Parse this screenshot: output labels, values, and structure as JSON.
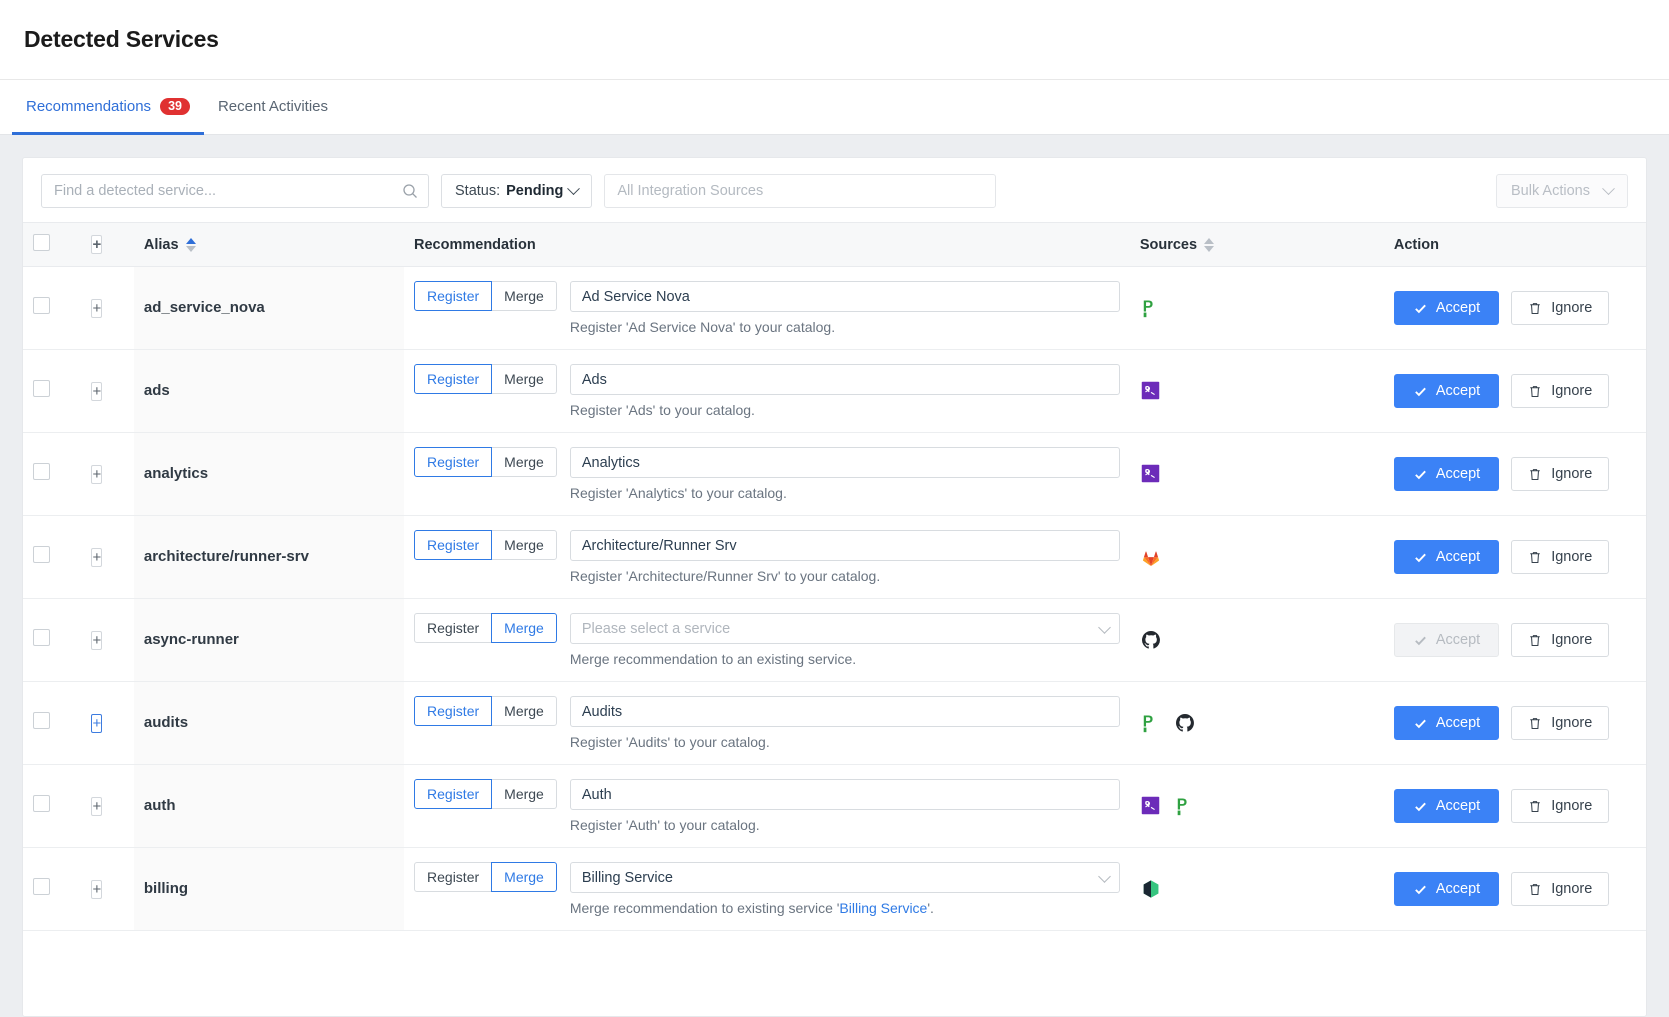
{
  "header": {
    "title": "Detected Services"
  },
  "tabs": [
    {
      "label": "Recommendations",
      "badge": "39",
      "active": true
    },
    {
      "label": "Recent Activities",
      "badge": "",
      "active": false
    }
  ],
  "toolbar": {
    "search_placeholder": "Find a detected service...",
    "search_value": "",
    "search_icon": "search-icon",
    "status_prefix": "Status:",
    "status_value": "Pending",
    "sources_filter_placeholder": "All Integration Sources",
    "bulk_actions_label": "Bulk Actions"
  },
  "table": {
    "columns": {
      "alias": "Alias",
      "recommendation": "Recommendation",
      "sources": "Sources",
      "action": "Action"
    },
    "expand_symbol": "+",
    "accept_label": "Accept",
    "ignore_label": "Ignore",
    "register_label": "Register",
    "merge_label": "Merge",
    "select_placeholder": "Please select a service"
  },
  "colors": {
    "accent": "#2f6fd8",
    "accept_button": "#3b82f6",
    "badge_red": "#e03131",
    "link": "#2f7ae5"
  },
  "rows": [
    {
      "alias": "ad_service_nova",
      "mode": "register",
      "value": "Ad Service Nova",
      "help_prefix": "Register 'Ad Service Nova' to your catalog.",
      "help_link": "",
      "help_suffix": "",
      "sources": [
        "prometheus-icon"
      ],
      "accept_enabled": true,
      "expander_highlight": false
    },
    {
      "alias": "ads",
      "mode": "register",
      "value": "Ads",
      "help_prefix": "Register 'Ads' to your catalog.",
      "help_link": "",
      "help_suffix": "",
      "sources": [
        "datadog-icon"
      ],
      "accept_enabled": true,
      "expander_highlight": false
    },
    {
      "alias": "analytics",
      "mode": "register",
      "value": "Analytics",
      "help_prefix": "Register 'Analytics' to your catalog.",
      "help_link": "",
      "help_suffix": "",
      "sources": [
        "datadog-icon"
      ],
      "accept_enabled": true,
      "expander_highlight": false
    },
    {
      "alias": "architecture/runner-srv",
      "mode": "register",
      "value": "Architecture/Runner Srv",
      "help_prefix": "Register 'Architecture/Runner Srv' to your catalog.",
      "help_link": "",
      "help_suffix": "",
      "sources": [
        "gitlab-icon"
      ],
      "accept_enabled": true,
      "expander_highlight": false
    },
    {
      "alias": "async-runner",
      "mode": "merge",
      "value": "",
      "help_prefix": "Merge recommendation to an existing service.",
      "help_link": "",
      "help_suffix": "",
      "sources": [
        "github-icon"
      ],
      "accept_enabled": false,
      "expander_highlight": false
    },
    {
      "alias": "audits",
      "mode": "register",
      "value": "Audits",
      "help_prefix": "Register 'Audits' to your catalog.",
      "help_link": "",
      "help_suffix": "",
      "sources": [
        "prometheus-icon",
        "github-icon"
      ],
      "accept_enabled": true,
      "expander_highlight": true
    },
    {
      "alias": "auth",
      "mode": "register",
      "value": "Auth",
      "help_prefix": "Register 'Auth' to your catalog.",
      "help_link": "",
      "help_suffix": "",
      "sources": [
        "datadog-icon",
        "prometheus-icon"
      ],
      "accept_enabled": true,
      "expander_highlight": false
    },
    {
      "alias": "billing",
      "mode": "merge",
      "value": "Billing Service",
      "help_prefix": "Merge recommendation to existing service '",
      "help_link": "Billing Service",
      "help_suffix": "'.",
      "sources": [
        "opsgenie-icon"
      ],
      "accept_enabled": true,
      "expander_highlight": false
    }
  ]
}
